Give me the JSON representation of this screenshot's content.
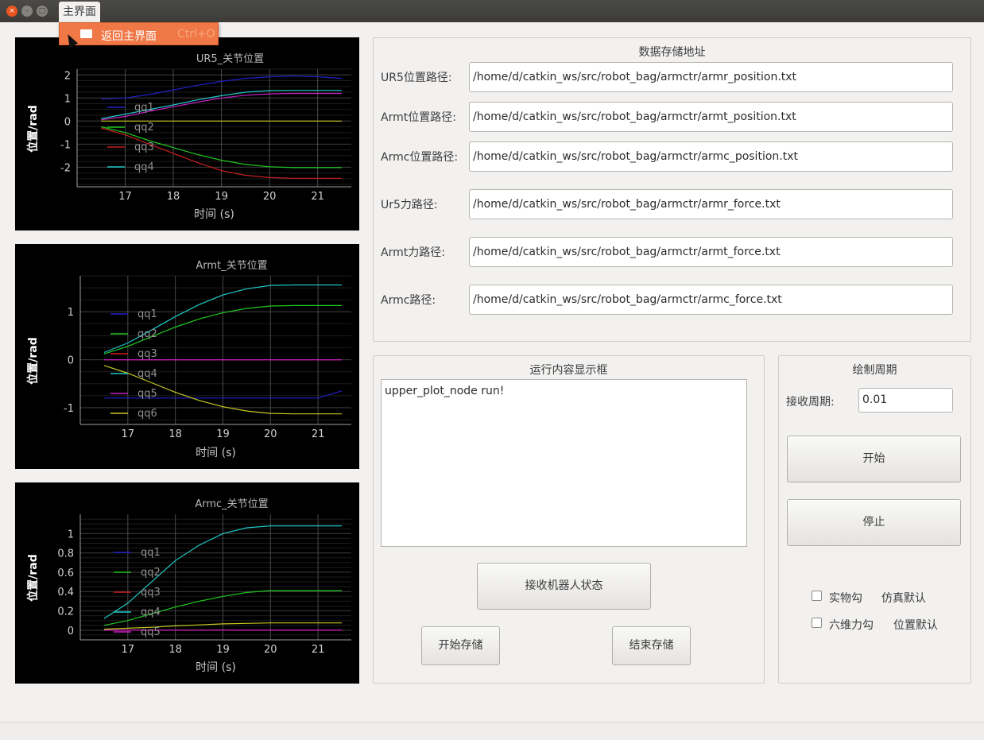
{
  "window": {
    "menu_label": "主界面",
    "close_glyph": "×",
    "min_glyph": "–",
    "max_glyph": "□"
  },
  "dropdown": {
    "item_label": "返回主界面",
    "shortcut": "Ctrl+O"
  },
  "plots": [
    {
      "title": "UR5_关节位置",
      "ylabel": "位置/rad",
      "xlabel": "时间 (s)",
      "x_ticks": [
        "17",
        "18",
        "19",
        "20",
        "21"
      ],
      "y_ticks": [
        "2",
        "1",
        "0",
        "-1",
        "-2"
      ],
      "legend": [
        "qq1",
        "qq2",
        "qq3",
        "qq4"
      ],
      "legend_colors": [
        "#2020c8",
        "#20c820",
        "#c82020",
        "#20c8c8"
      ]
    },
    {
      "title": "Armt_关节位置",
      "ylabel": "位置/rad",
      "xlabel": "时间 (s)",
      "x_ticks": [
        "17",
        "18",
        "19",
        "20",
        "21"
      ],
      "y_ticks": [
        "1",
        "0",
        "-1"
      ],
      "legend": [
        "qq1",
        "qq2",
        "qq3",
        "qq4",
        "qq5",
        "qq6"
      ],
      "legend_colors": [
        "#2020c8",
        "#20c820",
        "#c82020",
        "#20c8c8",
        "#c820c8",
        "#c8c820"
      ]
    },
    {
      "title": "Armc_关节位置",
      "ylabel": "位置/rad",
      "xlabel": "时间 (s)",
      "x_ticks": [
        "17",
        "18",
        "19",
        "20",
        "21"
      ],
      "y_ticks": [
        "1",
        "0.8",
        "0.6",
        "0.4",
        "0.2",
        "0"
      ],
      "legend": [
        "qq1",
        "qq2",
        "qq3",
        "qq4",
        "qq5"
      ],
      "legend_colors": [
        "#2020c8",
        "#20c820",
        "#c82020",
        "#20c8c8",
        "#c820c8"
      ]
    }
  ],
  "chart_data": [
    {
      "type": "line",
      "title": "UR5_关节位置",
      "xlabel": "时间 (s)",
      "ylabel": "位置/rad",
      "xlim": [
        16.0,
        21.7
      ],
      "ylim": [
        -2.85,
        2.25
      ],
      "grid": true,
      "legend_position": "left",
      "x": [
        16.5,
        17.0,
        17.5,
        18.0,
        18.5,
        19.0,
        19.5,
        20.0,
        20.5,
        21.0,
        21.5
      ],
      "series": [
        {
          "name": "qq1",
          "color": "#2020c8",
          "values": [
            0.95,
            1.0,
            1.15,
            1.35,
            1.55,
            1.72,
            1.85,
            1.92,
            1.95,
            1.92,
            1.85
          ]
        },
        {
          "name": "qq2",
          "color": "#20c820",
          "values": [
            -0.25,
            -0.5,
            -0.85,
            -1.15,
            -1.45,
            -1.7,
            -1.88,
            -1.98,
            -2.02,
            -2.02,
            -2.02
          ]
        },
        {
          "name": "qq3",
          "color": "#c82020",
          "values": [
            -0.3,
            -0.6,
            -1.0,
            -1.4,
            -1.8,
            -2.15,
            -2.35,
            -2.45,
            -2.48,
            -2.48,
            -2.48
          ]
        },
        {
          "name": "qq4",
          "color": "#20c8c8",
          "values": [
            0.1,
            0.3,
            0.5,
            0.7,
            0.92,
            1.1,
            1.25,
            1.32,
            1.33,
            1.33,
            1.33
          ]
        },
        {
          "name": "qq5",
          "color": "#c820c8",
          "values": [
            0.05,
            0.2,
            0.42,
            0.62,
            0.82,
            1.0,
            1.12,
            1.18,
            1.2,
            1.2,
            1.2
          ]
        },
        {
          "name": "qq6",
          "color": "#c8c820",
          "values": [
            0,
            0,
            0,
            0,
            0,
            0,
            0,
            0,
            0,
            0,
            0
          ]
        }
      ]
    },
    {
      "type": "line",
      "title": "Armt_关节位置",
      "xlabel": "时间 (s)",
      "ylabel": "位置/rad",
      "xlim": [
        16.0,
        21.7
      ],
      "ylim": [
        -1.35,
        1.75
      ],
      "grid": true,
      "legend_position": "left",
      "x": [
        16.5,
        17.0,
        17.5,
        18.0,
        18.5,
        19.0,
        19.5,
        20.0,
        20.5,
        21.0,
        21.5
      ],
      "series": [
        {
          "name": "qq1",
          "color": "#2020c8",
          "values": [
            -0.8,
            -0.8,
            -0.8,
            -0.8,
            -0.8,
            -0.8,
            -0.8,
            -0.8,
            -0.8,
            -0.8,
            -0.65
          ]
        },
        {
          "name": "qq2",
          "color": "#20c820",
          "values": [
            0.12,
            0.28,
            0.48,
            0.68,
            0.85,
            0.98,
            1.07,
            1.12,
            1.13,
            1.13,
            1.13
          ]
        },
        {
          "name": "qq3",
          "color": "#c82020",
          "values": [
            0,
            0,
            0,
            0,
            0,
            0,
            0,
            0,
            0,
            0,
            0
          ]
        },
        {
          "name": "qq4",
          "color": "#20c8c8",
          "values": [
            0.15,
            0.35,
            0.62,
            0.9,
            1.15,
            1.35,
            1.48,
            1.55,
            1.56,
            1.56,
            1.56
          ]
        },
        {
          "name": "qq5",
          "color": "#c820c8",
          "values": [
            0,
            0,
            0,
            0,
            0,
            0,
            0,
            0,
            0,
            0,
            0
          ]
        },
        {
          "name": "qq6",
          "color": "#c8c820",
          "values": [
            -0.12,
            -0.28,
            -0.48,
            -0.68,
            -0.85,
            -0.98,
            -1.07,
            -1.12,
            -1.13,
            -1.13,
            -1.13
          ]
        }
      ]
    },
    {
      "type": "line",
      "title": "Armc_关节位置",
      "xlabel": "时间 (s)",
      "ylabel": "位置/rad",
      "xlim": [
        16.0,
        21.7
      ],
      "ylim": [
        -0.1,
        1.2
      ],
      "grid": true,
      "legend_position": "left",
      "x": [
        16.5,
        17.0,
        17.5,
        18.0,
        18.5,
        19.0,
        19.5,
        20.0,
        20.5,
        21.0,
        21.5
      ],
      "series": [
        {
          "name": "qq1",
          "color": "#2020c8",
          "values": [
            0,
            0,
            0,
            0,
            0,
            0,
            0,
            0,
            0,
            0,
            0
          ]
        },
        {
          "name": "qq2",
          "color": "#20c820",
          "values": [
            0.05,
            0.1,
            0.17,
            0.24,
            0.3,
            0.35,
            0.39,
            0.41,
            0.41,
            0.41,
            0.41
          ]
        },
        {
          "name": "qq3",
          "color": "#c82020",
          "values": [
            0,
            0,
            0,
            0,
            0,
            0,
            0,
            0,
            0,
            0,
            0
          ]
        },
        {
          "name": "qq4",
          "color": "#20c8c8",
          "values": [
            0.12,
            0.28,
            0.5,
            0.72,
            0.88,
            1.0,
            1.06,
            1.08,
            1.08,
            1.08,
            1.08
          ]
        },
        {
          "name": "qq5",
          "color": "#c820c8",
          "values": [
            0,
            0,
            0,
            0,
            0,
            0,
            0,
            0,
            0,
            0,
            0
          ]
        },
        {
          "name": "qq6",
          "color": "#c8c820",
          "values": [
            0.01,
            0.02,
            0.03,
            0.045,
            0.055,
            0.065,
            0.07,
            0.075,
            0.075,
            0.075,
            0.075
          ]
        }
      ]
    }
  ],
  "storage": {
    "title": "数据存储地址",
    "rows": [
      {
        "label": "UR5位置路径:",
        "value": "/home/d/catkin_ws/src/robot_bag/armctr/armr_position.txt"
      },
      {
        "label": "Armt位置路径:",
        "value": "/home/d/catkin_ws/src/robot_bag/armctr/armt_position.txt"
      },
      {
        "label": "Armc位置路径:",
        "value": "/home/d/catkin_ws/src/robot_bag/armctr/armc_position.txt"
      },
      {
        "label": "Ur5力路径:",
        "value": "/home/d/catkin_ws/src/robot_bag/armctr/armr_force.txt"
      },
      {
        "label": "Armt力路径:",
        "value": "/home/d/catkin_ws/src/robot_bag/armctr/armt_force.txt"
      },
      {
        "label": "Armc路径:",
        "value": "/home/d/catkin_ws/src/robot_bag/armctr/armc_force.txt"
      }
    ]
  },
  "run_box": {
    "title": "运行内容显示框",
    "content": "upper_plot_node run!",
    "receive_button": "接收机器人状态",
    "start_save_button": "开始存储",
    "stop_save_button": "结束存储"
  },
  "period_box": {
    "title": "绘制周期",
    "label": "接收周期:",
    "value": "0.01",
    "start_button": "开始",
    "stop_button": "停止",
    "check1_label": "实物勾",
    "check1_default": "仿真默认",
    "check2_label": "六维力勾",
    "check2_default": "位置默认"
  }
}
